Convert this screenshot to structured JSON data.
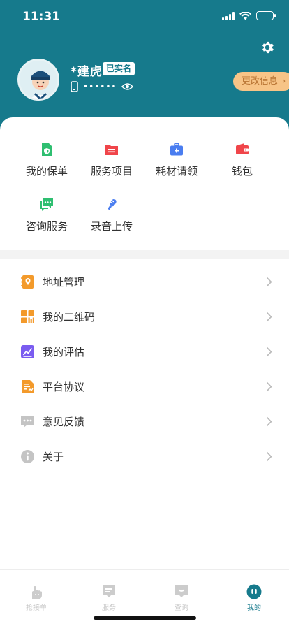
{
  "status_bar": {
    "time": "11:31"
  },
  "profile": {
    "name": "*建虎",
    "verified_badge": "已实名",
    "phone_mask": "••••••",
    "edit_button": "更改信息"
  },
  "grid": [
    {
      "label": "我的保单",
      "icon": "policy-icon",
      "color": "#2fbf71"
    },
    {
      "label": "服务项目",
      "icon": "folder-list-icon",
      "color": "#f0454a"
    },
    {
      "label": "耗材请领",
      "icon": "medical-kit-icon",
      "color": "#4a7df0"
    },
    {
      "label": "钱包",
      "icon": "wallet-icon",
      "color": "#f0454a"
    },
    {
      "label": "咨询服务",
      "icon": "chat-icon",
      "color": "#2fbf71"
    },
    {
      "label": "录音上传",
      "icon": "microphone-icon",
      "color": "#4a7df0"
    }
  ],
  "menu": [
    {
      "label": "地址管理",
      "icon": "address-book-icon",
      "color": "#f39a2b"
    },
    {
      "label": "我的二维码",
      "icon": "qr-code-icon",
      "color": "#f39a2b"
    },
    {
      "label": "我的评估",
      "icon": "assessment-icon",
      "color": "#7a5cf0"
    },
    {
      "label": "平台协议",
      "icon": "agreement-icon",
      "color": "#f39a2b"
    },
    {
      "label": "意见反馈",
      "icon": "feedback-icon",
      "color": "#c4c4c4"
    },
    {
      "label": "关于",
      "icon": "info-icon",
      "color": "#c4c4c4"
    }
  ],
  "tabs": [
    {
      "label": "抢接单",
      "icon": "hand-icon",
      "active": false
    },
    {
      "label": "服务",
      "icon": "service-icon",
      "active": false
    },
    {
      "label": "查询",
      "icon": "query-icon",
      "active": false
    },
    {
      "label": "我的",
      "icon": "me-icon",
      "active": true
    }
  ],
  "colors": {
    "brand": "#167a8c",
    "edit_button_bg": "#f7c487"
  }
}
